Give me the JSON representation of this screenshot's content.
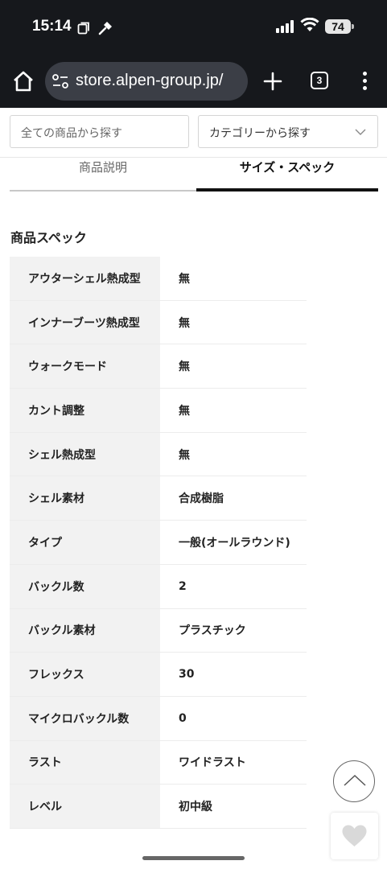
{
  "status_bar": {
    "time": "15:14",
    "battery": "74"
  },
  "browser": {
    "url": "store.alpen-group.jp/",
    "tab_count": "3"
  },
  "search": {
    "placeholder": "全ての商品から探す",
    "category_label": "カテゴリーから探す"
  },
  "tabs": [
    {
      "label": "商品説明",
      "active": false
    },
    {
      "label": "サイズ・スペック",
      "active": true
    }
  ],
  "spec_section": {
    "title": "商品スペック",
    "rows": [
      {
        "label": "アウターシェル熱成型",
        "value": "無"
      },
      {
        "label": "インナーブーツ熱成型",
        "value": "無"
      },
      {
        "label": "ウォークモード",
        "value": "無"
      },
      {
        "label": "カント調整",
        "value": "無"
      },
      {
        "label": "シェル熱成型",
        "value": "無"
      },
      {
        "label": "シェル素材",
        "value": "合成樹脂"
      },
      {
        "label": "タイプ",
        "value": "一般(オールラウンド)"
      },
      {
        "label": "バックル数",
        "value": "2"
      },
      {
        "label": "バックル素材",
        "value": "プラスチック"
      },
      {
        "label": "フレックス",
        "value": "30"
      },
      {
        "label": "マイクロバックル数",
        "value": "0"
      },
      {
        "label": "ラスト",
        "value": "ワイドラスト"
      },
      {
        "label": "レベル",
        "value": "初中級"
      }
    ]
  },
  "icons": {
    "status": [
      "sim-icon",
      "hammer-icon",
      "signal-icon",
      "wifi-icon",
      "battery-icon"
    ],
    "browser": [
      "home-icon",
      "site-settings-icon",
      "plus-icon",
      "tabs-icon",
      "more-icon"
    ],
    "page": [
      "chevron-down-icon",
      "scroll-top-icon",
      "heart-icon"
    ]
  }
}
